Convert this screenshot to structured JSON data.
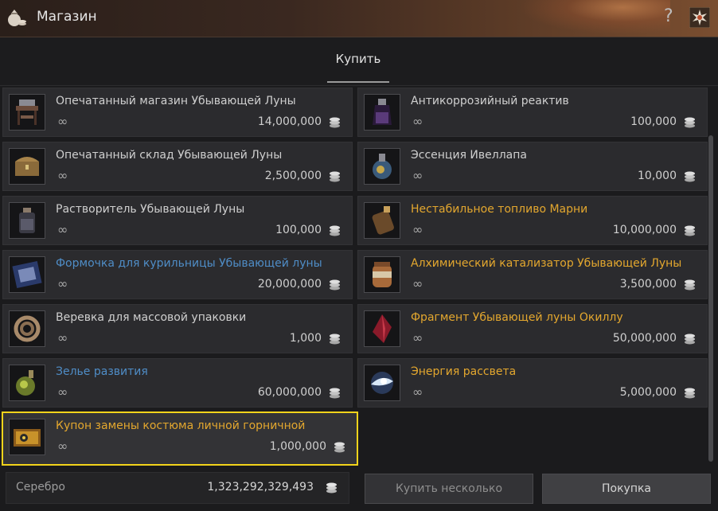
{
  "window": {
    "title": "Магазин",
    "help_label": "?"
  },
  "tabs": [
    {
      "label": "Купить",
      "active": true
    }
  ],
  "items_left": [
    {
      "name": "Опечатанный магазин Убывающей Луны",
      "limit": "∞",
      "price": "14,000,000",
      "color": "#cfcfcf",
      "icon": "shop-stand-icon"
    },
    {
      "name": "Опечатанный склад Убывающей Луны",
      "limit": "∞",
      "price": "2,500,000",
      "color": "#cfcfcf",
      "icon": "chest-icon"
    },
    {
      "name": "Растворитель Убывающей Луны",
      "limit": "∞",
      "price": "100,000",
      "color": "#cfcfcf",
      "icon": "bottle-icon"
    },
    {
      "name": "Формочка для курильницы Убывающей луны",
      "limit": "∞",
      "price": "20,000,000",
      "color": "#4f8dc7",
      "icon": "mold-icon"
    },
    {
      "name": "Веревка для массовой упаковки",
      "limit": "∞",
      "price": "1,000",
      "color": "#cfcfcf",
      "icon": "rope-icon"
    },
    {
      "name": "Зелье развития",
      "limit": "∞",
      "price": "60,000,000",
      "color": "#4f8dc7",
      "icon": "potion-icon"
    },
    {
      "name": "Купон замены костюма личной горничной",
      "limit": "∞",
      "price": "1,000,000",
      "color": "#e3a72e",
      "icon": "coupon-icon",
      "selected": true
    }
  ],
  "items_right": [
    {
      "name": "Антикоррозийный реактив",
      "limit": "∞",
      "price": "100,000",
      "color": "#cfcfcf",
      "icon": "reagent-icon"
    },
    {
      "name": "Эссенция Ивеллапа",
      "limit": "∞",
      "price": "10,000",
      "color": "#cfcfcf",
      "icon": "essence-icon"
    },
    {
      "name": "Нестабильное топливо Марни",
      "limit": "∞",
      "price": "10,000,000",
      "color": "#e3a72e",
      "icon": "fuel-icon"
    },
    {
      "name": "Алхимический катализатор Убывающей Луны",
      "limit": "∞",
      "price": "3,500,000",
      "color": "#e3a72e",
      "icon": "jar-icon"
    },
    {
      "name": "Фрагмент Убывающей луны Окиллу",
      "limit": "∞",
      "price": "50,000,000",
      "color": "#e3a72e",
      "icon": "crystal-icon"
    },
    {
      "name": "Энергия рассвета",
      "limit": "∞",
      "price": "5,000,000",
      "color": "#e3a72e",
      "icon": "energy-icon"
    }
  ],
  "footer": {
    "silver_label": "Серебро",
    "silver_value": "1,323,292,329,493",
    "buy_multiple_label": "Купить несколько",
    "buy_label": "Покупка"
  },
  "colors": {
    "selected_border": "#f2d31b",
    "gold_text": "#e3a72e",
    "blue_text": "#4f8dc7"
  }
}
